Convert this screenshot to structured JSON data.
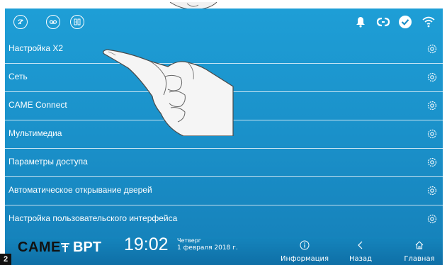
{
  "menu": {
    "items": [
      {
        "label": "Настройка X2"
      },
      {
        "label": "Сеть"
      },
      {
        "label": "CAME Connect"
      },
      {
        "label": "Мультимедиа"
      },
      {
        "label": "Параметры доступа"
      },
      {
        "label": "Автоматическое открывание дверей"
      },
      {
        "label": "Настройка пользовательского интерфейса"
      }
    ]
  },
  "bottom": {
    "brand": "CAME",
    "brand_sub": "BPT",
    "time": "19:02",
    "day": "Четверг",
    "date": "1 февраля 2018 г.",
    "info_label": "Информация",
    "back_label": "Назад",
    "home_label": "Главная"
  },
  "figure_number": "2",
  "colors": {
    "screen_top": "#1e9ed6",
    "screen_bottom": "#157fb8",
    "divider": "#ffffff",
    "text": "#ffffff"
  }
}
